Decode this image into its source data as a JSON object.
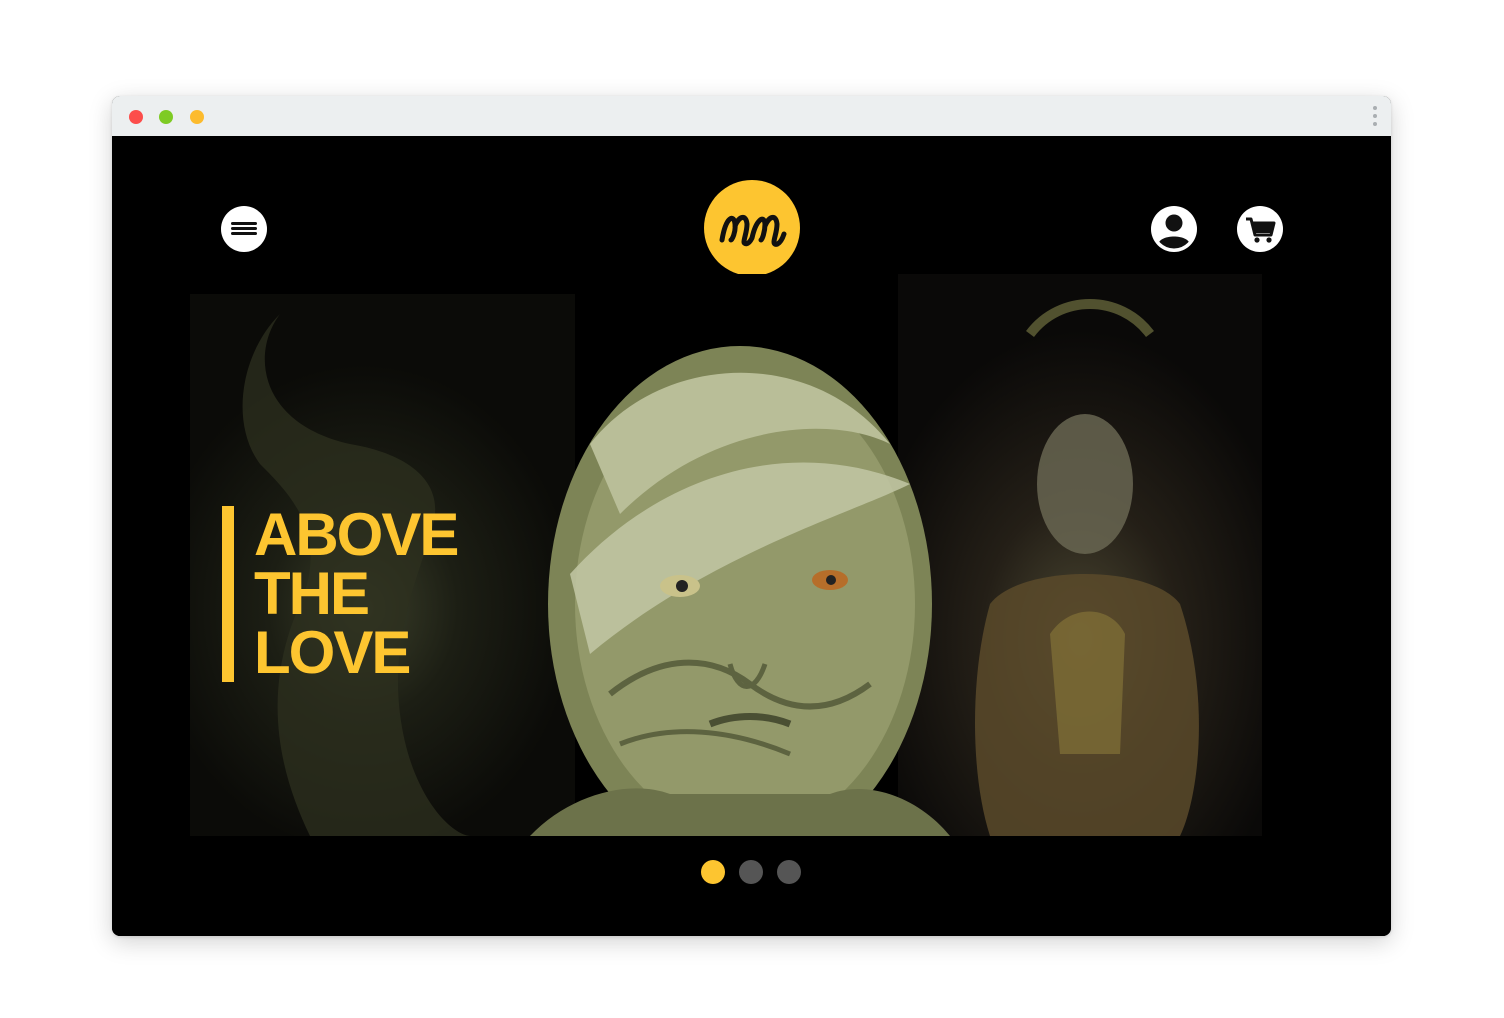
{
  "browser": {
    "controls": [
      "close",
      "minimize",
      "maximize"
    ],
    "menu_icon": "kebab-menu-icon"
  },
  "header": {
    "menu_icon": "hamburger-menu-icon",
    "logo_text": "mm",
    "account_icon": "user-account-icon",
    "cart_icon": "shopping-cart-icon"
  },
  "hero": {
    "headline_lines": [
      "ABOVE",
      "THE",
      "LOVE"
    ],
    "images": [
      "creature-sculpture-left",
      "green-creature-face-center",
      "woodland-creature-right"
    ]
  },
  "carousel": {
    "slide_count": 3,
    "active_index": 0
  },
  "colors": {
    "accent": "#fdc530",
    "background": "#000000",
    "inactive_dot": "#555555"
  }
}
